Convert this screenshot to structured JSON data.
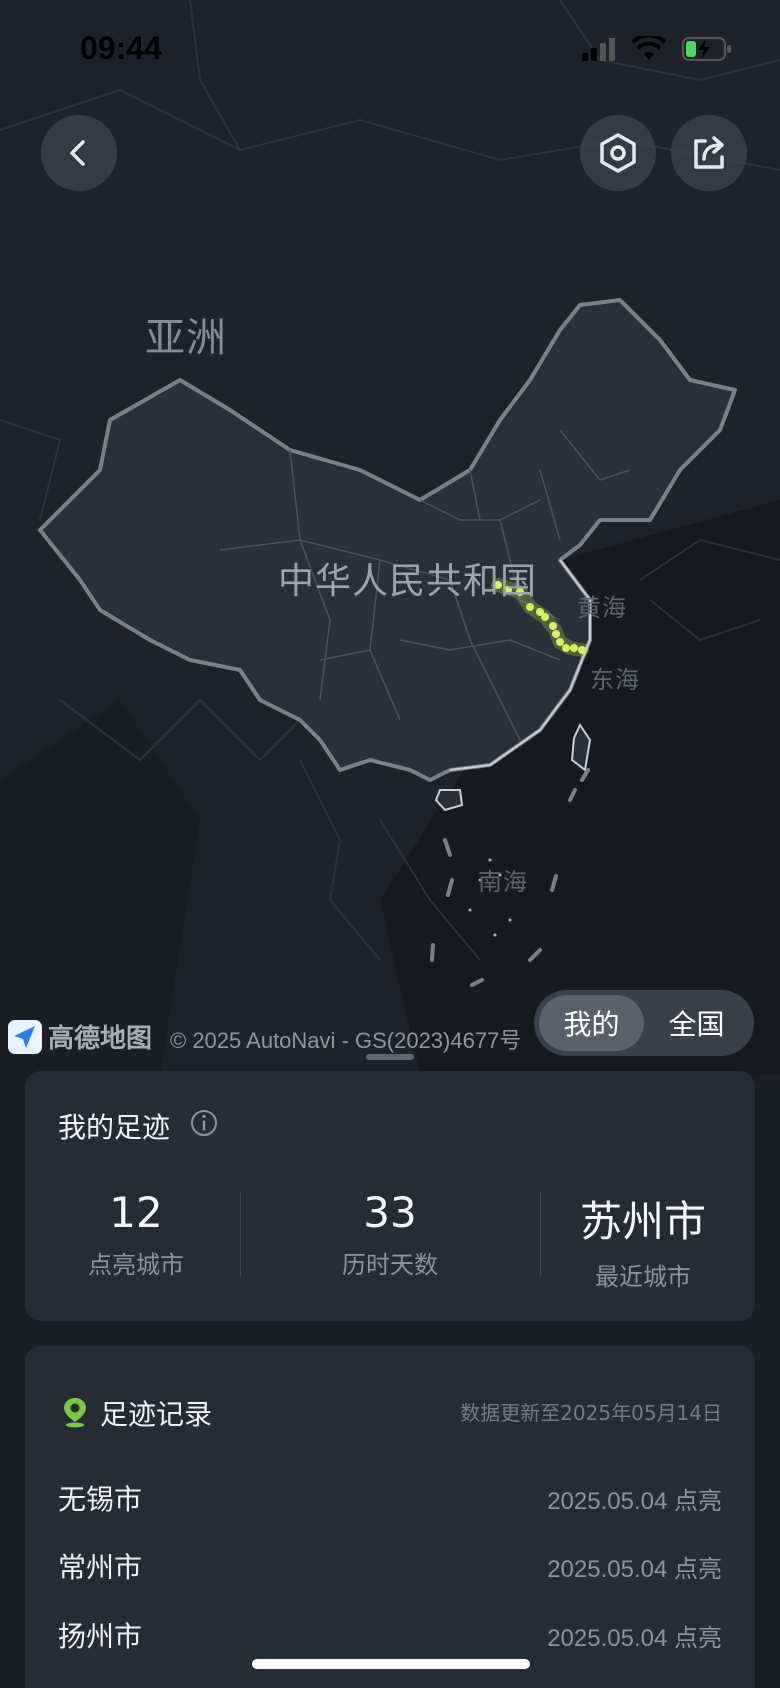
{
  "status_bar": {
    "time": "09:44"
  },
  "map": {
    "labels": {
      "asia": "亚洲",
      "china": "中华人民共和国",
      "yellow_sea": "黄海",
      "east_sea": "东海",
      "south_sea": "南海"
    },
    "attribution": {
      "logo_text": "高德地图",
      "copyright": "© 2025 AutoNavi - GS(2023)4677号"
    },
    "highlight_color": "#c8f04a"
  },
  "toggle": {
    "mine": "我的",
    "national": "全国",
    "selected": "我的"
  },
  "footprint_summary": {
    "title": "我的足迹",
    "stats": [
      {
        "value": "12",
        "label": "点亮城市"
      },
      {
        "value": "33",
        "label": "历时天数"
      },
      {
        "value": "苏州市",
        "label": "最近城市"
      }
    ]
  },
  "records": {
    "title": "足迹记录",
    "updated": "数据更新至2025年05月14日",
    "items": [
      {
        "city": "无锡市",
        "date": "2025.05.04 点亮"
      },
      {
        "city": "常州市",
        "date": "2025.05.04 点亮"
      },
      {
        "city": "扬州市",
        "date": "2025.05.04 点亮"
      }
    ]
  },
  "icons": {
    "back": "chevron-left-icon",
    "settings": "hexagon-settings-icon",
    "share": "share-icon",
    "info": "info-icon",
    "location": "location-pin-icon"
  }
}
